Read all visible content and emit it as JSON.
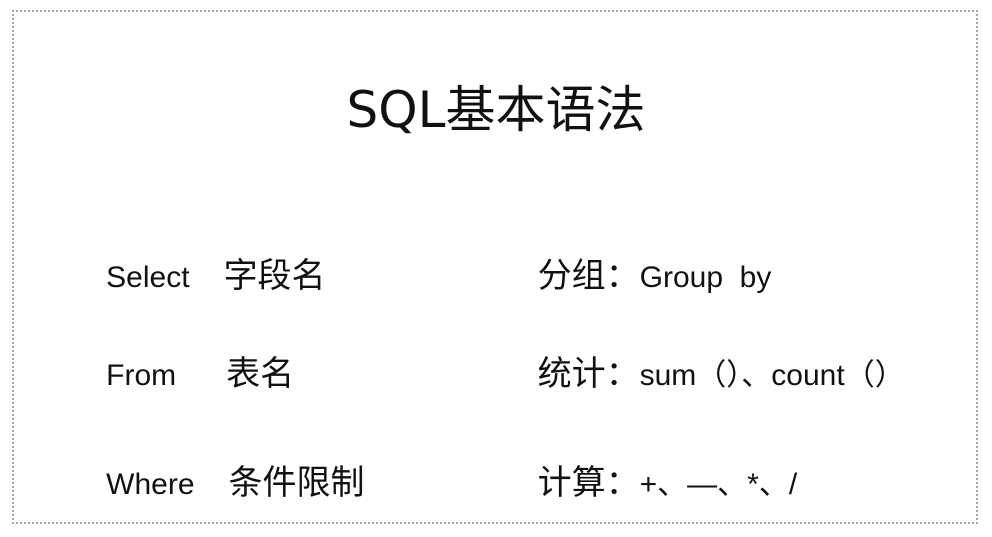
{
  "title": "SQL基本语法",
  "left_items": [
    {
      "keyword": "Select",
      "desc": "字段名"
    },
    {
      "keyword": "From",
      "desc": "表名"
    },
    {
      "keyword": "Where",
      "desc": "条件限制"
    }
  ],
  "right_items": [
    {
      "label": "分组：",
      "value": "Group  by"
    },
    {
      "label": "统计：",
      "value": "sum（）、count（）"
    },
    {
      "label": "计算：",
      "value": "+、—、*、/"
    }
  ]
}
